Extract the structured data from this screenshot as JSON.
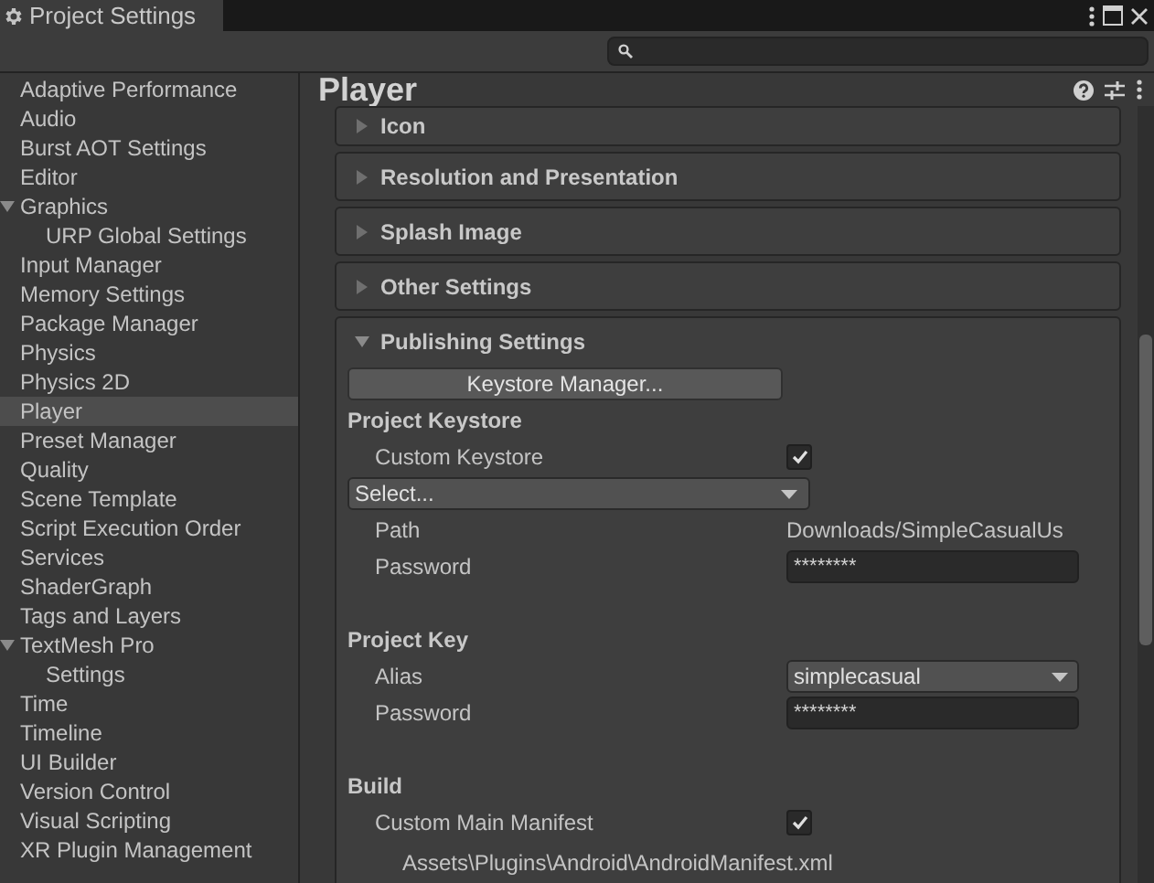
{
  "window": {
    "title": "Project Settings"
  },
  "sidebar": {
    "items": [
      {
        "label": "Adaptive Performance",
        "selected": false
      },
      {
        "label": "Audio",
        "selected": false
      },
      {
        "label": "Burst AOT Settings",
        "selected": false
      },
      {
        "label": "Editor",
        "selected": false
      },
      {
        "label": "Graphics",
        "selected": false,
        "expanded": true,
        "children": [
          {
            "label": "URP Global Settings",
            "selected": false
          }
        ]
      },
      {
        "label": "Input Manager",
        "selected": false
      },
      {
        "label": "Memory Settings",
        "selected": false
      },
      {
        "label": "Package Manager",
        "selected": false
      },
      {
        "label": "Physics",
        "selected": false
      },
      {
        "label": "Physics 2D",
        "selected": false
      },
      {
        "label": "Player",
        "selected": true
      },
      {
        "label": "Preset Manager",
        "selected": false
      },
      {
        "label": "Quality",
        "selected": false
      },
      {
        "label": "Scene Template",
        "selected": false
      },
      {
        "label": "Script Execution Order",
        "selected": false
      },
      {
        "label": "Services",
        "selected": false
      },
      {
        "label": "ShaderGraph",
        "selected": false
      },
      {
        "label": "Tags and Layers",
        "selected": false
      },
      {
        "label": "TextMesh Pro",
        "selected": false,
        "expanded": true,
        "children": [
          {
            "label": "Settings",
            "selected": false
          }
        ]
      },
      {
        "label": "Time",
        "selected": false
      },
      {
        "label": "Timeline",
        "selected": false
      },
      {
        "label": "UI Builder",
        "selected": false
      },
      {
        "label": "Version Control",
        "selected": false
      },
      {
        "label": "Visual Scripting",
        "selected": false
      },
      {
        "label": "XR Plugin Management",
        "selected": false
      }
    ]
  },
  "main": {
    "title": "Player",
    "sections": [
      {
        "title": "Icon",
        "expanded": false
      },
      {
        "title": "Resolution and Presentation",
        "expanded": false
      },
      {
        "title": "Splash Image",
        "expanded": false
      },
      {
        "title": "Other Settings",
        "expanded": false
      },
      {
        "title": "Publishing Settings",
        "expanded": true,
        "rows": [
          {
            "kind": "button",
            "label": "Keystore Manager..."
          },
          {
            "kind": "heading",
            "label": "Project Keystore"
          },
          {
            "kind": "checkbox",
            "label": "Custom Keystore",
            "checked": true
          },
          {
            "kind": "select",
            "value": "Select..."
          },
          {
            "kind": "text",
            "label": "Path",
            "value": "Downloads/SimpleCasualUs"
          },
          {
            "kind": "password",
            "label": "Password",
            "value": "********"
          },
          {
            "kind": "heading",
            "label": "Project Key"
          },
          {
            "kind": "dropdown",
            "label": "Alias",
            "value": "simplecasual"
          },
          {
            "kind": "password",
            "label": "Password",
            "value": "********"
          },
          {
            "kind": "heading",
            "label": "Build"
          },
          {
            "kind": "checkbox",
            "label": "Custom Main Manifest",
            "checked": true
          },
          {
            "kind": "note",
            "value": "Assets\\Plugins\\Android\\AndroidManifest.xml"
          }
        ]
      }
    ]
  }
}
